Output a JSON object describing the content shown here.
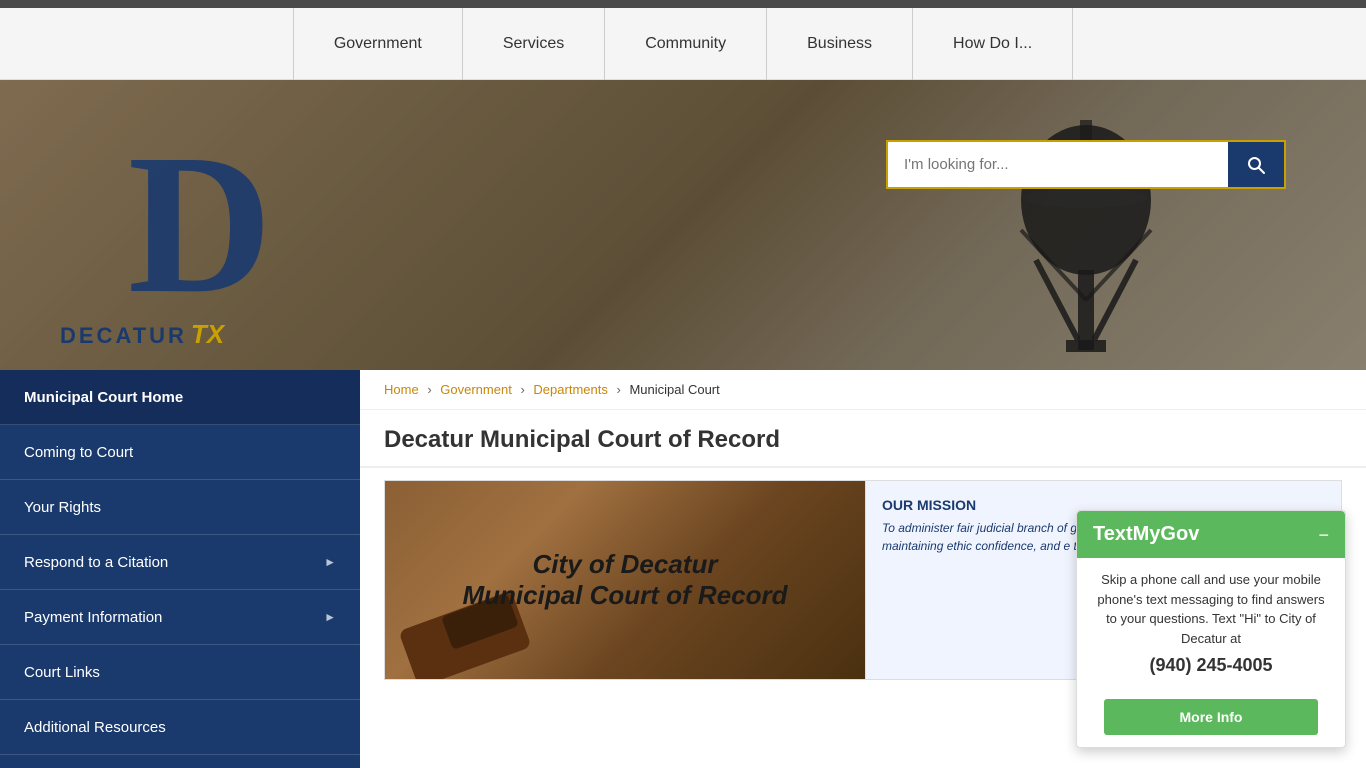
{
  "topbar": {},
  "nav": {
    "items": [
      {
        "label": "Government",
        "id": "government"
      },
      {
        "label": "Services",
        "id": "services"
      },
      {
        "label": "Community",
        "id": "community"
      },
      {
        "label": "Business",
        "id": "business"
      },
      {
        "label": "How Do I...",
        "id": "how-do-i"
      }
    ]
  },
  "hero": {
    "search_placeholder": "I'm looking for..."
  },
  "logo": {
    "letter": "D",
    "city": "DECATUR",
    "state": "TX"
  },
  "sidebar": {
    "items": [
      {
        "label": "Municipal Court Home",
        "id": "court-home",
        "arrow": false,
        "active": true
      },
      {
        "label": "Coming to Court",
        "id": "coming-to-court",
        "arrow": false
      },
      {
        "label": "Your Rights",
        "id": "your-rights",
        "arrow": false
      },
      {
        "label": "Respond to a Citation",
        "id": "respond-citation",
        "arrow": true
      },
      {
        "label": "Payment Information",
        "id": "payment-info",
        "arrow": true
      },
      {
        "label": "Court Links",
        "id": "court-links",
        "arrow": false
      },
      {
        "label": "Additional Resources",
        "id": "additional-resources",
        "arrow": false
      }
    ]
  },
  "breadcrumb": {
    "items": [
      {
        "label": "Home",
        "href": "#"
      },
      {
        "label": "Government",
        "href": "#"
      },
      {
        "label": "Departments",
        "href": "#"
      },
      {
        "label": "Municipal Court",
        "href": null
      }
    ]
  },
  "page": {
    "title": "Decatur Municipal Court of Record"
  },
  "court_image": {
    "line1": "City of Decatur",
    "line2": "Municipal Court of Record"
  },
  "mission": {
    "title": "OUR MISSION",
    "text": "To administer fair judicial branch of government. The prompt, courteous maintaining ethic confidence, and e the court are proc and timely manne"
  },
  "textmygov": {
    "title": "TextMyGov",
    "close_label": "−",
    "body": "Skip a phone call and use your mobile phone's text messaging to find answers to your questions. Text \"Hi\" to City of Decatur at",
    "phone": "(940) 245-4005",
    "more_info_label": "More Info"
  }
}
